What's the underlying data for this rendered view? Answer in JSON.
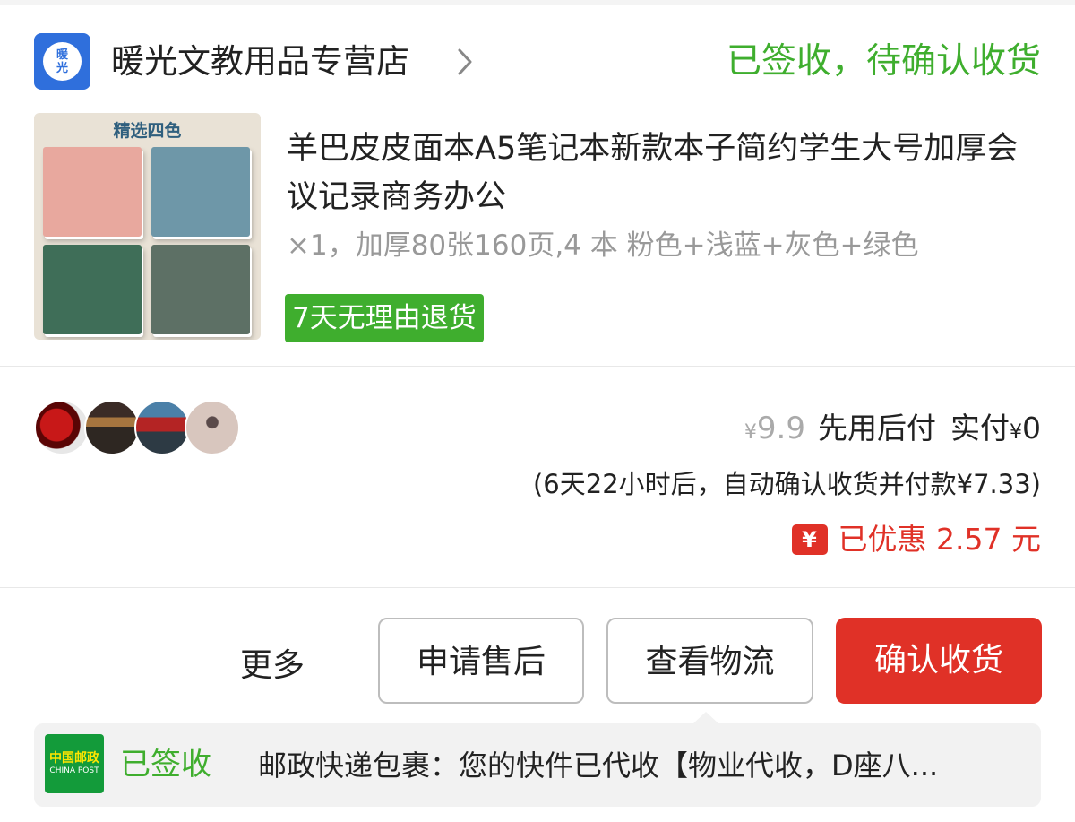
{
  "shop": {
    "logo_text": "暖光",
    "name": "暖光文教用品专营店"
  },
  "order": {
    "status": "已签收，待确认收货",
    "status_color": "#3fae2e"
  },
  "product": {
    "image_banner": "精选四色",
    "title": "羊巴皮皮面本A5笔记本新款本子简约学生大号加厚会议记录商务办公",
    "spec": "×1，加厚80张160页,4 本 粉色+浅蓝+灰色+绿色",
    "return_tag": "7天无理由退货",
    "notebook_colors": [
      "#e8a89e",
      "#6e97a8",
      "#3f6e58",
      "#5d7065"
    ]
  },
  "price": {
    "currency": "¥",
    "original": "9.9",
    "pay_later": "先用后付",
    "paid_label": "实付",
    "paid_value": "0",
    "auto_confirm": "(6天22小时后，自动确认收货并付款¥7.33)",
    "discount_icon": "¥",
    "discount_text": "已优惠 2.57 元",
    "accent_color": "#e03127"
  },
  "avatars": [
    "avatar-red-gem",
    "avatar-street-sign",
    "avatar-storefront",
    "avatar-portrait"
  ],
  "actions": {
    "more": "更多",
    "after_sale": "申请售后",
    "logistics": "查看物流",
    "confirm": "确认收货"
  },
  "logistics": {
    "carrier_logo_cn": "中国邮政",
    "carrier_logo_en": "CHINA POST",
    "status": "已签收",
    "message": "邮政快递包裹：您的快件已代收【物业代收，D座八..."
  }
}
